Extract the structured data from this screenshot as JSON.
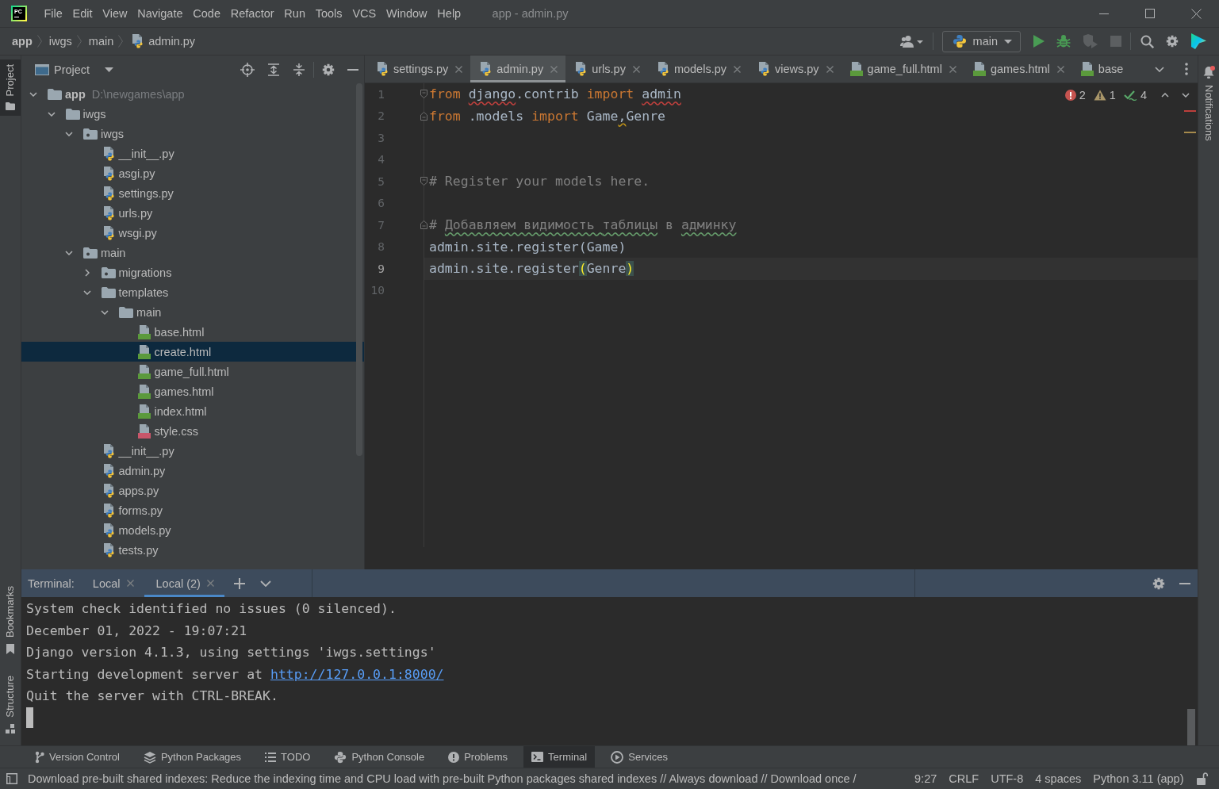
{
  "window": {
    "logo_text": "PC",
    "menu": [
      "File",
      "Edit",
      "View",
      "Navigate",
      "Code",
      "Refactor",
      "Run",
      "Tools",
      "VCS",
      "Window",
      "Help"
    ],
    "title": "app - admin.py"
  },
  "navigation_bar": {
    "breadcrumbs": [
      {
        "label": "app",
        "kind": "root"
      },
      {
        "label": "iwgs",
        "kind": "folder"
      },
      {
        "label": "main",
        "kind": "folder"
      },
      {
        "label": "admin.py",
        "kind": "python"
      }
    ],
    "run_configuration": "main"
  },
  "left_stripe": {
    "top": [
      {
        "label": "Project",
        "kind": "project",
        "selected": true
      }
    ],
    "bottom": [
      {
        "label": "Bookmarks",
        "kind": "bookmarks",
        "selected": false
      },
      {
        "label": "Structure",
        "kind": "structure",
        "selected": false
      }
    ]
  },
  "project_panel": {
    "title": "Project",
    "tree": [
      {
        "label": "app",
        "path": "D:\\newgames\\app",
        "kind": "folder",
        "expanded": true,
        "selected": false,
        "children": [
          {
            "label": "iwgs",
            "kind": "folder",
            "expanded": true,
            "selected": false,
            "children": [
              {
                "label": "iwgs",
                "kind": "package",
                "expanded": true,
                "selected": false,
                "children": [
                  {
                    "label": "__init__.py",
                    "kind": "python",
                    "selected": false
                  },
                  {
                    "label": "asgi.py",
                    "kind": "python",
                    "selected": false
                  },
                  {
                    "label": "settings.py",
                    "kind": "python",
                    "selected": false
                  },
                  {
                    "label": "urls.py",
                    "kind": "python",
                    "selected": false
                  },
                  {
                    "label": "wsgi.py",
                    "kind": "python",
                    "selected": false
                  }
                ]
              },
              {
                "label": "main",
                "kind": "package",
                "expanded": true,
                "selected": false,
                "children": [
                  {
                    "label": "migrations",
                    "kind": "package",
                    "expanded": false,
                    "selected": false
                  },
                  {
                    "label": "templates",
                    "kind": "folder",
                    "expanded": true,
                    "selected": false,
                    "children": [
                      {
                        "label": "main",
                        "kind": "folder",
                        "expanded": true,
                        "selected": false,
                        "children": [
                          {
                            "label": "base.html",
                            "kind": "html",
                            "selected": false
                          },
                          {
                            "label": "create.html",
                            "kind": "html",
                            "selected": true
                          },
                          {
                            "label": "game_full.html",
                            "kind": "html",
                            "selected": false
                          },
                          {
                            "label": "games.html",
                            "kind": "html",
                            "selected": false
                          },
                          {
                            "label": "index.html",
                            "kind": "html",
                            "selected": false
                          },
                          {
                            "label": "style.css",
                            "kind": "css",
                            "selected": false
                          }
                        ]
                      }
                    ]
                  },
                  {
                    "label": "__init__.py",
                    "kind": "python",
                    "selected": false
                  },
                  {
                    "label": "admin.py",
                    "kind": "python",
                    "selected": false
                  },
                  {
                    "label": "apps.py",
                    "kind": "python",
                    "selected": false
                  },
                  {
                    "label": "forms.py",
                    "kind": "python",
                    "selected": false
                  },
                  {
                    "label": "models.py",
                    "kind": "python",
                    "selected": false
                  },
                  {
                    "label": "tests.py",
                    "kind": "python",
                    "selected": false
                  }
                ]
              }
            ]
          }
        ]
      }
    ]
  },
  "editor": {
    "tabs": [
      {
        "label": "settings.py",
        "kind": "python",
        "selected": false,
        "close": true
      },
      {
        "label": "admin.py",
        "kind": "python",
        "selected": true,
        "close": true
      },
      {
        "label": "urls.py",
        "kind": "python",
        "selected": false,
        "close": true
      },
      {
        "label": "models.py",
        "kind": "python",
        "selected": false,
        "close": true
      },
      {
        "label": "views.py",
        "kind": "python",
        "selected": false,
        "close": true
      },
      {
        "label": "game_full.html",
        "kind": "html",
        "selected": false,
        "close": true
      },
      {
        "label": "games.html",
        "kind": "html",
        "selected": false,
        "close": true
      },
      {
        "label": "base",
        "kind": "html",
        "selected": false,
        "close": false
      }
    ],
    "inspections": {
      "errors": "2",
      "warnings": "1",
      "typos": "4"
    },
    "lines": [
      {
        "number": "1",
        "fold_start": true,
        "fold_end": false,
        "current": false,
        "tokens": [
          {
            "text": "from ",
            "kind": "keyword"
          },
          {
            "text": "django",
            "kind": "error"
          },
          {
            "text": ".contrib ",
            "kind": "plain"
          },
          {
            "text": "import ",
            "kind": "keyword"
          },
          {
            "text": "admin",
            "kind": "error"
          }
        ]
      },
      {
        "number": "2",
        "fold_start": false,
        "fold_end": true,
        "current": false,
        "tokens": [
          {
            "text": "from",
            "kind": "keyword"
          },
          {
            "text": " .models ",
            "kind": "plain"
          },
          {
            "text": "import",
            "kind": "keyword"
          },
          {
            "text": " Game",
            "kind": "plain"
          },
          {
            "text": ",",
            "kind": "warning"
          },
          {
            "text": "Genre",
            "kind": "plain"
          }
        ]
      },
      {
        "number": "3",
        "fold_start": false,
        "fold_end": false,
        "current": false
      },
      {
        "number": "4",
        "fold_start": false,
        "fold_end": false,
        "current": false
      },
      {
        "number": "5",
        "fold_start": true,
        "fold_end": false,
        "current": false,
        "tokens": [
          {
            "text": "# Register your models here.",
            "kind": "comment"
          }
        ]
      },
      {
        "number": "6",
        "fold_start": false,
        "fold_end": false,
        "current": false
      },
      {
        "number": "7",
        "fold_start": false,
        "fold_end": true,
        "current": false,
        "tokens": [
          {
            "text": "# ",
            "kind": "comment"
          },
          {
            "text": "Добавляем ",
            "kind": "typo"
          },
          {
            "text": "видимость ",
            "kind": "typo"
          },
          {
            "text": "таблицы",
            "kind": "typo"
          },
          {
            "text": " в ",
            "kind": "comment"
          },
          {
            "text": "админку",
            "kind": "typo"
          }
        ]
      },
      {
        "number": "8",
        "fold_start": false,
        "fold_end": false,
        "current": false,
        "tokens": [
          {
            "text": "admin.site.register(Game)",
            "kind": "plain"
          }
        ]
      },
      {
        "number": "9",
        "fold_start": false,
        "fold_end": false,
        "current": true,
        "tokens": [
          {
            "text": "admin.site.register",
            "kind": "plain"
          },
          {
            "text": "(",
            "kind": "brace"
          },
          {
            "text": "Genre",
            "kind": "plain"
          },
          {
            "text": ")",
            "kind": "brace"
          }
        ]
      },
      {
        "number": "10",
        "fold_start": false,
        "fold_end": false,
        "current": false
      }
    ]
  },
  "terminal": {
    "title": "Terminal:",
    "tabs": [
      {
        "label": "Local",
        "selected": false
      },
      {
        "label": "Local (2)",
        "selected": true
      }
    ],
    "lines": [
      {
        "text": "System check identified no issues (0 silenced)."
      },
      {
        "text": "December 01, 2022 - 19:07:21"
      },
      {
        "text": "Django version 4.1.3, using settings 'iwgs.settings'"
      },
      {
        "text": "Starting development server at ",
        "link": "http://127.0.0.1:8000/"
      },
      {
        "text": "Quit the server with CTRL-BREAK."
      }
    ]
  },
  "right_stripe": [
    {
      "label": "Notifications",
      "kind": "notifications",
      "selected": false
    }
  ],
  "tool_window_bar": [
    {
      "label": "Version Control",
      "kind": "vcs",
      "selected": false
    },
    {
      "label": "Python Packages",
      "kind": "packages",
      "selected": false
    },
    {
      "label": "TODO",
      "kind": "todo",
      "selected": false
    },
    {
      "label": "Python Console",
      "kind": "console",
      "selected": false
    },
    {
      "label": "Problems",
      "kind": "problems",
      "selected": false
    },
    {
      "label": "Terminal",
      "kind": "terminal",
      "selected": true
    },
    {
      "label": "Services",
      "kind": "services",
      "selected": false
    }
  ],
  "status_bar": {
    "message": "Download pre-built shared indexes: Reduce the indexing time and CPU load with pre-built Python packages shared indexes // Always download // Download once /",
    "items": [
      "9:27",
      "CRLF",
      "UTF-8",
      "4 spaces",
      "Python 3.11 (app)"
    ]
  }
}
